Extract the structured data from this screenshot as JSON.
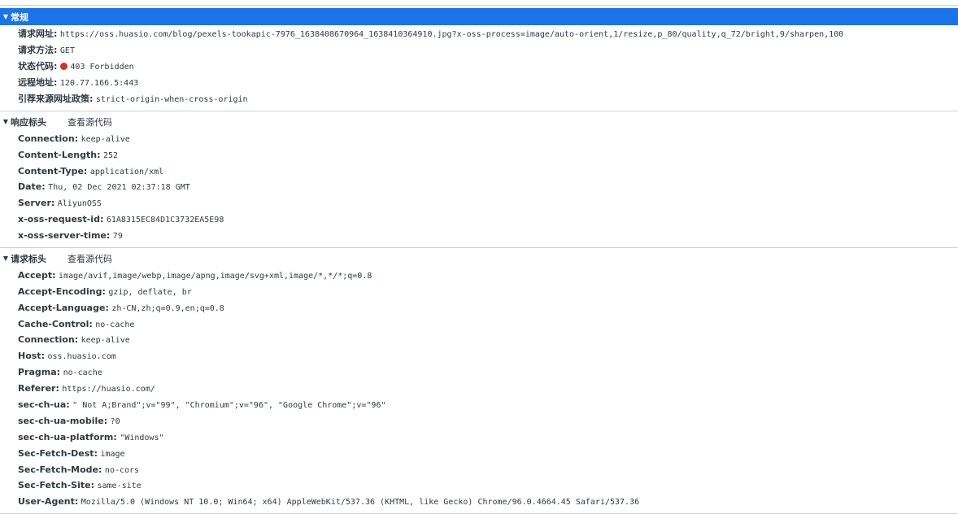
{
  "general": {
    "title": "常规",
    "items": [
      {
        "key": "请求网址:",
        "value": "https://oss.huasio.com/blog/pexels-tookapic-7976_1638408670964_1638410364910.jpg?x-oss-process=image/auto-orient,1/resize,p_80/quality,q_72/bright,9/sharpen,100"
      },
      {
        "key": "请求方法:",
        "value": "GET"
      },
      {
        "key": "状态代码:",
        "value": "403 Forbidden",
        "status_color": "#d93025"
      },
      {
        "key": "远程地址:",
        "value": "120.77.166.5:443"
      },
      {
        "key": "引荐来源网址政策:",
        "value": "strict-origin-when-cross-origin"
      }
    ]
  },
  "response_headers": {
    "title": "响应标头",
    "view_source": "查看源代码",
    "items": [
      {
        "key": "Connection:",
        "value": "keep-alive"
      },
      {
        "key": "Content-Length:",
        "value": "252"
      },
      {
        "key": "Content-Type:",
        "value": "application/xml"
      },
      {
        "key": "Date:",
        "value": "Thu, 02 Dec 2021 02:37:18 GMT"
      },
      {
        "key": "Server:",
        "value": "AliyunOSS"
      },
      {
        "key": "x-oss-request-id:",
        "value": "61A8315EC84D1C3732EA5E98"
      },
      {
        "key": "x-oss-server-time:",
        "value": "79"
      }
    ]
  },
  "request_headers": {
    "title": "请求标头",
    "view_source": "查看源代码",
    "items": [
      {
        "key": "Accept:",
        "value": "image/avif,image/webp,image/apng,image/svg+xml,image/*,*/*;q=0.8"
      },
      {
        "key": "Accept-Encoding:",
        "value": "gzip, deflate, br"
      },
      {
        "key": "Accept-Language:",
        "value": "zh-CN,zh;q=0.9,en;q=0.8"
      },
      {
        "key": "Cache-Control:",
        "value": "no-cache"
      },
      {
        "key": "Connection:",
        "value": "keep-alive"
      },
      {
        "key": "Host:",
        "value": "oss.huasio.com"
      },
      {
        "key": "Pragma:",
        "value": "no-cache"
      },
      {
        "key": "Referer:",
        "value": "https://huasio.com/"
      },
      {
        "key": "sec-ch-ua:",
        "value": "\" Not A;Brand\";v=\"99\", \"Chromium\";v=\"96\", \"Google Chrome\";v=\"96\""
      },
      {
        "key": "sec-ch-ua-mobile:",
        "value": "?0"
      },
      {
        "key": "sec-ch-ua-platform:",
        "value": "\"Windows\""
      },
      {
        "key": "Sec-Fetch-Dest:",
        "value": "image"
      },
      {
        "key": "Sec-Fetch-Mode:",
        "value": "no-cors"
      },
      {
        "key": "Sec-Fetch-Site:",
        "value": "same-site"
      },
      {
        "key": "User-Agent:",
        "value": "Mozilla/5.0 (Windows NT 10.0; Win64; x64) AppleWebKit/537.36 (KHTML, like Gecko) Chrome/96.0.4664.45 Safari/537.36"
      }
    ]
  }
}
